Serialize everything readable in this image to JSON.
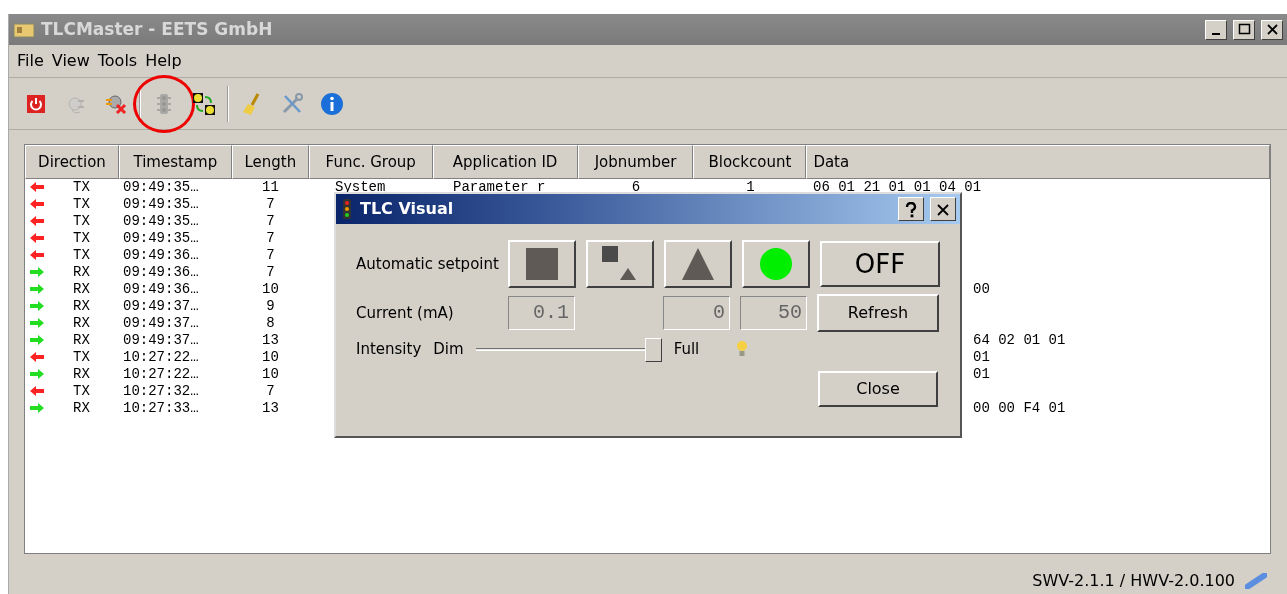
{
  "window": {
    "title": "TLCMaster - EETS GmbH"
  },
  "menu": [
    "File",
    "View",
    "Tools",
    "Help"
  ],
  "toolbar": [
    {
      "kind": "power",
      "disabled": false
    },
    {
      "kind": "plug",
      "disabled": true
    },
    {
      "kind": "disconnect",
      "disabled": false
    },
    {
      "kind": "separator"
    },
    {
      "kind": "traffic-light",
      "disabled": true,
      "highlighted": true
    },
    {
      "kind": "swap",
      "disabled": false
    },
    {
      "kind": "separator"
    },
    {
      "kind": "broom",
      "disabled": false
    },
    {
      "kind": "tools",
      "disabled": false
    },
    {
      "kind": "info",
      "disabled": false
    }
  ],
  "table": {
    "columns": [
      "Direction",
      "Timestamp",
      "Length",
      "Func. Group",
      "Application ID",
      "Jobnumber",
      "Blockcount",
      "Data"
    ],
    "rows": [
      {
        "kind": "tx",
        "direction": "TX",
        "timestamp": "09:49:35…",
        "length": "11",
        "func_group": "System",
        "application_id": "Parameter r",
        "jobnumber": "6",
        "blockcount": "1",
        "data": "06 01 21 01 01 04 01",
        "data_covered": false
      },
      {
        "kind": "tx",
        "direction": "TX",
        "timestamp": "09:49:35…",
        "length": "7"
      },
      {
        "kind": "tx",
        "direction": "TX",
        "timestamp": "09:49:35…",
        "length": "7"
      },
      {
        "kind": "tx",
        "direction": "TX",
        "timestamp": "09:49:35…",
        "length": "7"
      },
      {
        "kind": "tx",
        "direction": "TX",
        "timestamp": "09:49:36…",
        "length": "7"
      },
      {
        "kind": "rx",
        "direction": "RX",
        "timestamp": "09:49:36…",
        "length": "7"
      },
      {
        "kind": "rx",
        "direction": "RX",
        "timestamp": "09:49:36…",
        "length": "10",
        "data": "00",
        "data_covered": true
      },
      {
        "kind": "rx",
        "direction": "RX",
        "timestamp": "09:49:37…",
        "length": "9"
      },
      {
        "kind": "rx",
        "direction": "RX",
        "timestamp": "09:49:37…",
        "length": "8"
      },
      {
        "kind": "rx",
        "direction": "RX",
        "timestamp": "09:49:37…",
        "length": "13",
        "data": "64 02 01 01",
        "data_covered": true
      },
      {
        "kind": "tx",
        "direction": "TX",
        "timestamp": "10:27:22…",
        "length": "10",
        "data": "01",
        "data_covered": true
      },
      {
        "kind": "rx",
        "direction": "RX",
        "timestamp": "10:27:22…",
        "length": "10",
        "data": "01",
        "data_covered": true
      },
      {
        "kind": "tx",
        "direction": "TX",
        "timestamp": "10:27:32…",
        "length": "7"
      },
      {
        "kind": "rx",
        "direction": "RX",
        "timestamp": "10:27:33…",
        "length": "13",
        "data": "00 00 F4 01",
        "data_covered": true
      }
    ]
  },
  "dialog": {
    "title": "TLC Visual",
    "setpoint_label": "Automatic setpoint",
    "setpoint_buttons": [
      {
        "kind": "square"
      },
      {
        "kind": "square-triangle"
      },
      {
        "kind": "triangle"
      },
      {
        "kind": "circle"
      }
    ],
    "off_button": "OFF",
    "current_label": "Current (mA)",
    "current_fields": [
      {
        "kind": "left",
        "value": "0.1"
      },
      {
        "kind": "right",
        "value": "0"
      },
      {
        "kind": "right",
        "value": "50"
      }
    ],
    "refresh_button": "Refresh",
    "intensity_label": "Intensity",
    "slider": {
      "min_label": "Dim",
      "max_label": "Full",
      "level": 1
    },
    "close_button": "Close"
  },
  "status_bar": {
    "version": "SWV-2.1.1 / HWV-2.0.100"
  }
}
